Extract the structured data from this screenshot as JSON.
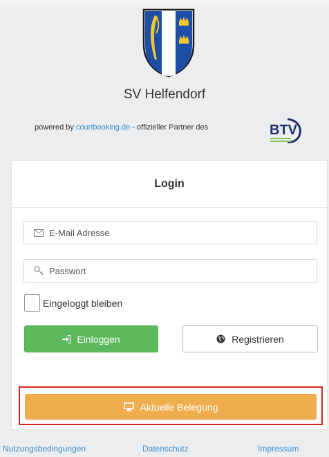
{
  "header": {
    "club_name": "SV Helfendorf",
    "powered_prefix": "powered by ",
    "powered_link": "courtbooking.de",
    "powered_suffix": " - offizieller Partner des",
    "partner_logo_text": "BTV"
  },
  "login": {
    "title": "Login",
    "email_placeholder": "E-Mail Adresse",
    "password_placeholder": "Passwort",
    "remember_label": "Eingeloggt bleiben",
    "remember_checked": false,
    "login_button": "Einloggen",
    "register_button": "Registrieren",
    "occupancy_button": "Aktuelle Belegung"
  },
  "footer": {
    "terms": "Nutzungsbedingungen",
    "privacy": "Datenschutz",
    "imprint": "Impressum"
  },
  "icons": {
    "email": "envelope-icon",
    "password": "key-icon",
    "login": "sign-in-icon",
    "register": "globe-icon",
    "occupancy": "monitor-icon"
  },
  "colors": {
    "login_button": "#5cb85c",
    "occupancy_button": "#f0ad4e",
    "highlight_border": "#d9231f",
    "link": "#3a8fd1"
  }
}
